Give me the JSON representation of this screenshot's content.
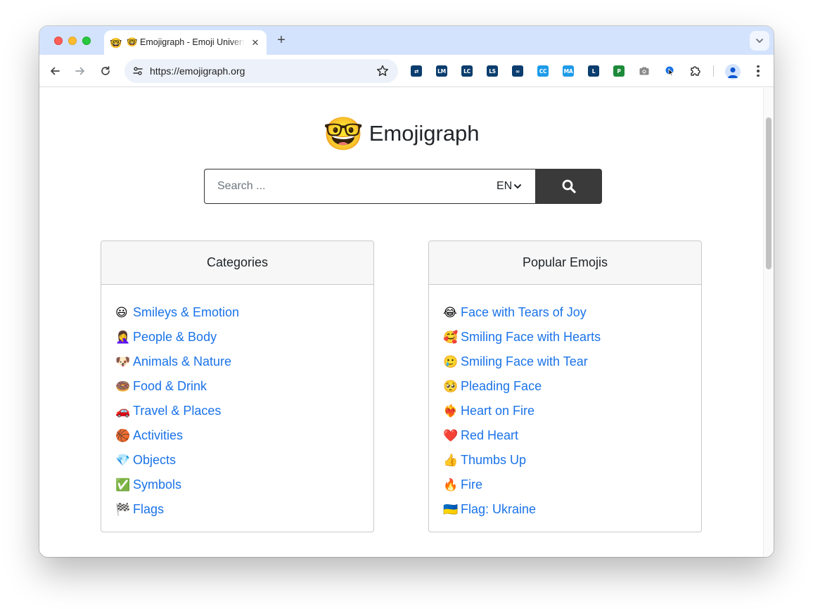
{
  "tab": {
    "favicon": "🤓",
    "title": "🤓 Emojigraph - Emoji Universe",
    "close": "✕"
  },
  "toolbar": {
    "url": "https://emojigraph.org"
  },
  "extensions": [
    {
      "name": "swap-extension-icon",
      "label": "⇄",
      "color": "#0b3d6e"
    },
    {
      "name": "lm-extension-icon",
      "label": "LM",
      "color": "#0b3d6e"
    },
    {
      "name": "lc-extension-icon",
      "label": "LC",
      "color": "#0b3d6e"
    },
    {
      "name": "ls-extension-icon",
      "label": "LS",
      "color": "#0b3d6e"
    },
    {
      "name": "link-extension-icon",
      "label": "∞",
      "color": "#0b3d6e"
    },
    {
      "name": "cc-extension-icon",
      "label": "CC",
      "color": "#1e9be9"
    },
    {
      "name": "ma-extension-icon",
      "label": "MA",
      "color": "#1e9be9"
    },
    {
      "name": "l-extension-icon",
      "label": "L",
      "color": "#0b3d6e"
    },
    {
      "name": "p-extension-icon",
      "label": "P",
      "color": "#1d8a3a"
    }
  ],
  "page": {
    "logo_emoji": "🤓",
    "site_title": "Emojigraph",
    "search": {
      "placeholder": "Search ...",
      "value": "",
      "language": "EN"
    }
  },
  "categories": {
    "title": "Categories",
    "items": [
      {
        "emoji": "😃",
        "label": "Smileys & Emotion"
      },
      {
        "emoji": "🤦‍♀️",
        "label": "People & Body"
      },
      {
        "emoji": "🐶",
        "label": "Animals & Nature"
      },
      {
        "emoji": "🍩",
        "label": "Food & Drink"
      },
      {
        "emoji": "🚗",
        "label": "Travel & Places"
      },
      {
        "emoji": "🏀",
        "label": "Activities"
      },
      {
        "emoji": "💎",
        "label": "Objects"
      },
      {
        "emoji": "✅",
        "label": "Symbols"
      },
      {
        "emoji": "🏁",
        "label": "Flags"
      }
    ]
  },
  "popular": {
    "title": "Popular Emojis",
    "items": [
      {
        "emoji": "😂",
        "label": "Face with Tears of Joy"
      },
      {
        "emoji": "🥰",
        "label": "Smiling Face with Hearts"
      },
      {
        "emoji": "🥲",
        "label": "Smiling Face with Tear"
      },
      {
        "emoji": "🥺",
        "label": "Pleading Face"
      },
      {
        "emoji": "❤️‍🔥",
        "label": "Heart on Fire"
      },
      {
        "emoji": "❤️",
        "label": "Red Heart"
      },
      {
        "emoji": "👍",
        "label": "Thumbs Up"
      },
      {
        "emoji": "🔥",
        "label": "Fire"
      },
      {
        "emoji": "🇺🇦",
        "label": "Flag: Ukraine"
      }
    ]
  },
  "colors": {
    "link": "#1a73e8",
    "search_button": "#3a3a3a",
    "tab_strip": "#d3e3fd",
    "omnibox": "#edf2fa"
  }
}
